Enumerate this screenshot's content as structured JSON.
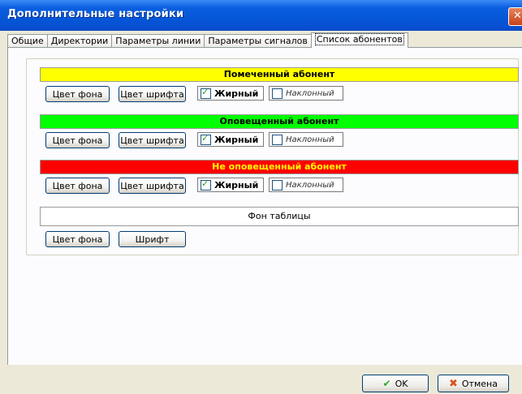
{
  "window": {
    "title": "Дополнительные настройки",
    "close_glyph": "✕"
  },
  "tabs": [
    {
      "label": "Общие"
    },
    {
      "label": "Директории"
    },
    {
      "label": "Параметры линии"
    },
    {
      "label": "Параметры сигналов"
    },
    {
      "label": "Список абонентов",
      "active": true
    }
  ],
  "sections": [
    {
      "title": "Помеченный абонент",
      "bg_color": "#ffff00",
      "text_color": "#000000",
      "bg_button": "Цвет фона",
      "font_button": "Цвет шрифта",
      "bold_label": "Жирный",
      "bold_checked": true,
      "italic_label": "Наклонный",
      "italic_checked": false
    },
    {
      "title": "Оповещенный абонент",
      "bg_color": "#00ff00",
      "text_color": "#000000",
      "bg_button": "Цвет фона",
      "font_button": "Цвет шрифта",
      "bold_label": "Жирный",
      "bold_checked": true,
      "italic_label": "Наклонный",
      "italic_checked": false
    },
    {
      "title": "Не оповещенный  абонент",
      "bg_color": "#ff0000",
      "text_color": "#ffff00",
      "bg_button": "Цвет фона",
      "font_button": "Цвет шрифта",
      "bold_label": "Жирный",
      "bold_checked": true,
      "italic_label": "Наклонный",
      "italic_checked": false
    }
  ],
  "table_bg": {
    "title": "Фон таблицы",
    "bg_button": "Цвет фона",
    "font_button": "Шрифт"
  },
  "footer": {
    "ok_label": "OK",
    "cancel_label": "Отмена",
    "ok_icon": "checkmark-icon",
    "cancel_icon": "cross-icon"
  }
}
